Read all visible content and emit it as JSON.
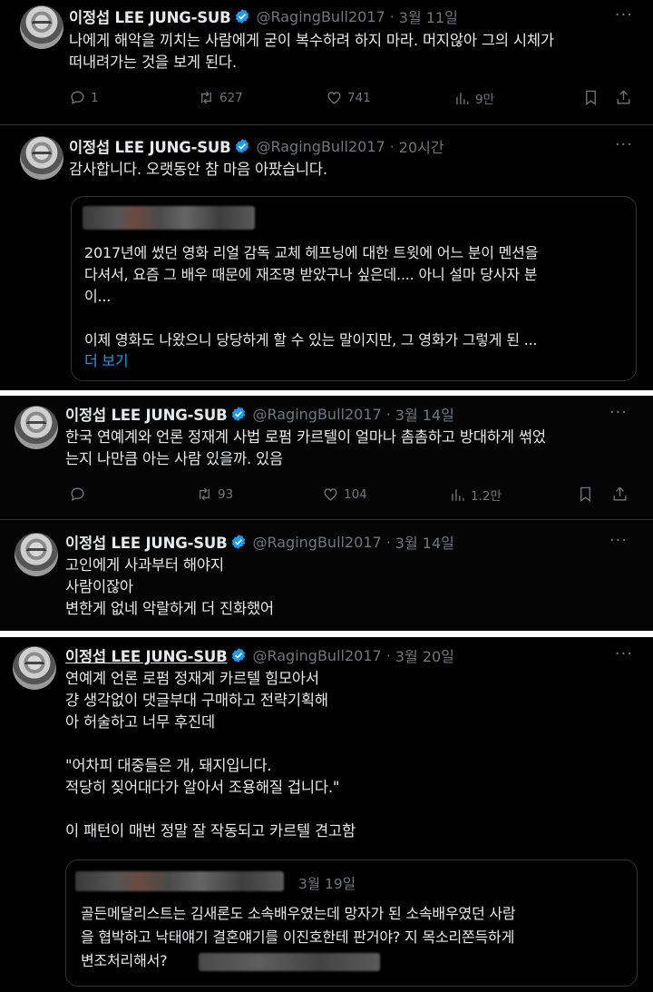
{
  "colors": {
    "background": "#000000",
    "text": "#e7e9ea",
    "muted": "#71767b",
    "accent": "#1d9bf0",
    "divider": "#2f3336"
  },
  "tweets": [
    {
      "name": "이정섭 LEE JUNG-SUB",
      "handle": "@RagingBull2017",
      "sep": "·",
      "time": "3월 11일",
      "more": "···",
      "text": "나에게 해악을 끼치는 사람에게 굳이 복수하려 하지 마라. 머지않아 그의 시체가\n떠내려가는 것을 보게 된다.",
      "replies": "1",
      "retweets": "627",
      "likes": "741",
      "views": "9만"
    },
    {
      "name": "이정섭 LEE JUNG-SUB",
      "handle": "@RagingBull2017",
      "sep": "·",
      "time": "20시간",
      "more": "···",
      "text": "감사합니다. 오랫동안 참 마음 아팠습니다.",
      "quote": {
        "text": "2017년에 썼던 영화 리얼 감독 교체 헤프닝에 대한 트윗에 어느 분이 멘션을\n다셔서, 요즘 그 배우 때문에 재조명 받았구나 싶은데.... 아니 설마 당사자 분\n이...\n\n이제 영화도 나왔으니 당당하게 할 수 있는 말이지만, 그 영화가 그렇게 된 ...",
        "more": "더 보기"
      }
    },
    {
      "name": "이정섭 LEE JUNG-SUB",
      "handle": "@RagingBull2017",
      "sep": "·",
      "time": "3월 14일",
      "more": "···",
      "text": "한국 연예계와 언론 정재계 사법 로펌 카르텔이 얼마나 촘촘하고 방대하게 썪었\n는지 나만큼 아는 사람 있을까. 있음",
      "replies": "",
      "retweets": "93",
      "likes": "104",
      "views": "1.2만"
    },
    {
      "name": "이정섭 LEE JUNG-SUB",
      "handle": "@RagingBull2017",
      "sep": "·",
      "time": "3월 14일",
      "more": "···",
      "text": "고인에게 사과부터 해야지\n사람이잖아\n변한게 없네 악랄하게 더 진화했어"
    },
    {
      "name": "이정섭 LEE JUNG-SUB",
      "handle": "@RagingBull2017",
      "sep": "·",
      "time": "3월 20일",
      "more": "···",
      "text": "연예계 언론 로펌 정재계 카르텔 힘모아서\n걍 생각없이 댓글부대 구매하고 전략기획해\n아 허술하고 너무 후진데\n\n\"어차피 대중들은 개, 돼지입니다.\n적당히 짖어대다가 알아서 조용해질 겁니다.\"\n\n이 패턴이 매번 정말 잘 작동되고 카르텔 견고함",
      "quote": {
        "time": "3월 19일",
        "text": "골든메달리스트는 김새론도 소속배우였는데 망자가 된 소속배우였던 사람\n을 협박하고 낙태얘기 결혼얘기를 이진호한테 판거야? 지 목소리쫀득하게\n변조처리해서?"
      }
    }
  ]
}
